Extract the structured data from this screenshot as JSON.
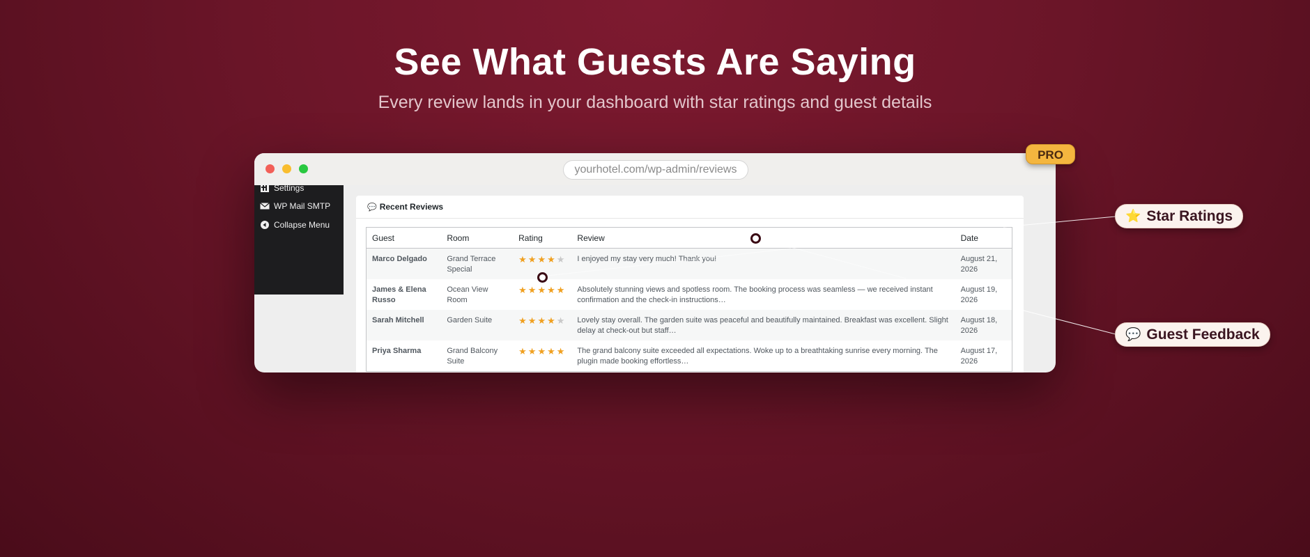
{
  "hero": {
    "title": "See What Guests Are Saying",
    "subtitle": "Every review lands in your dashboard with star ratings and guest details"
  },
  "browser": {
    "url": "yourhotel.com/wp-admin/reviews"
  },
  "sidebar": {
    "items": [
      {
        "label": "Settings",
        "icon": "settings-icon"
      },
      {
        "label": "WP Mail SMTP",
        "icon": "mail-icon"
      },
      {
        "label": "Collapse Menu",
        "icon": "collapse-icon"
      }
    ]
  },
  "panel": {
    "title": "Recent Reviews",
    "icon": "speech-bubble-icon"
  },
  "table": {
    "headers": {
      "guest": "Guest",
      "room": "Room",
      "rating": "Rating",
      "review": "Review",
      "date": "Date"
    },
    "rows": [
      {
        "guest": "Marco Delgado",
        "room": "Grand Terrace Special",
        "rating": 4,
        "review": "I enjoyed my stay very much! Thank you!",
        "date": "August 21, 2026"
      },
      {
        "guest": "James & Elena Russo",
        "room": "Ocean View Room",
        "rating": 5,
        "review": "Absolutely stunning views and spotless room. The booking process was seamless — we received instant confirmation and the check-in instructions…",
        "date": "August 19, 2026"
      },
      {
        "guest": "Sarah Mitchell",
        "room": "Garden Suite",
        "rating": 4,
        "review": "Lovely stay overall. The garden suite was peaceful and beautifully maintained. Breakfast was excellent. Slight delay at check-out but staff…",
        "date": "August 18, 2026"
      },
      {
        "guest": "Priya Sharma",
        "room": "Grand Balcony Suite",
        "rating": 5,
        "review": "The grand balcony suite exceeded all expectations. Woke up to a breathtaking sunrise every morning. The plugin made booking effortless…",
        "date": "August 17, 2026"
      }
    ]
  },
  "badge": {
    "label": "PRO"
  },
  "callouts": {
    "star_ratings": {
      "label": "Star Ratings",
      "icon": "star-icon"
    },
    "guest_feedback": {
      "label": "Guest Feedback",
      "icon": "speech-bubble-icon"
    }
  },
  "colors": {
    "background": "#6a1528",
    "star": "#f0a020",
    "star_empty": "#c9c9c9",
    "badge": "#f4b63f",
    "sidebar": "#1d1d1f"
  }
}
